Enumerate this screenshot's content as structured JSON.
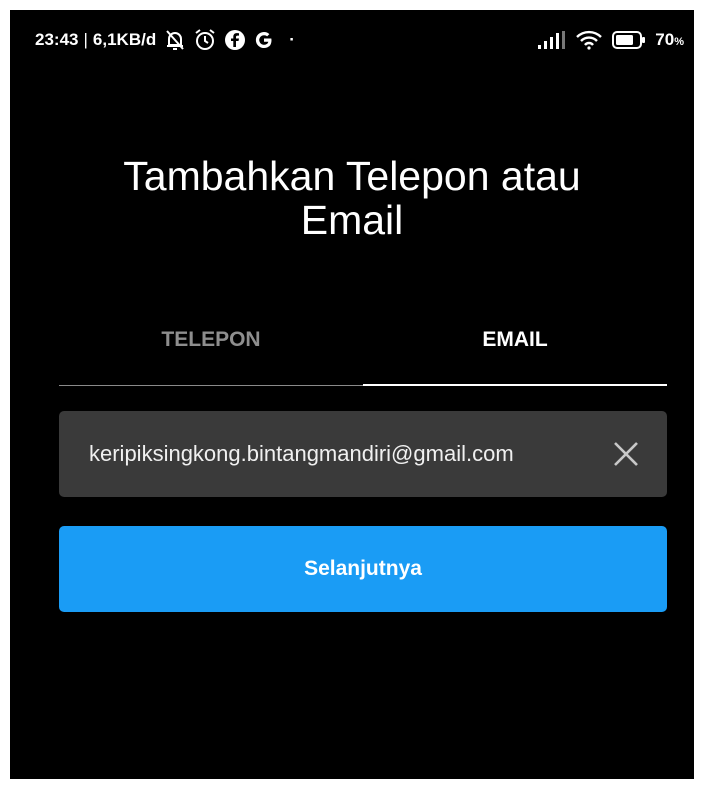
{
  "status_bar": {
    "time": "23:43",
    "separator": "|",
    "network_speed": "6,1KB/d",
    "dot": "·",
    "battery_percent": "70",
    "battery_unit": "%"
  },
  "title": {
    "line1": "Tambahkan Telepon atau",
    "line2": "Email"
  },
  "tabs": [
    {
      "label": "TELEPON",
      "active": false
    },
    {
      "label": "EMAIL",
      "active": true
    }
  ],
  "email_field": {
    "value": "keripiksingkong.bintangmandiri@gmail.com"
  },
  "next_button": {
    "label": "Selanjutnya"
  },
  "colors": {
    "background": "#000000",
    "field_background": "#3a3a3a",
    "button_primary": "#1a9cf5",
    "inactive_tab": "#8e8e8e"
  },
  "icons": [
    "bell-off-icon",
    "alarm-icon",
    "facebook-icon",
    "google-icon",
    "signal-icon",
    "wifi-icon",
    "battery-icon",
    "clear-icon"
  ]
}
